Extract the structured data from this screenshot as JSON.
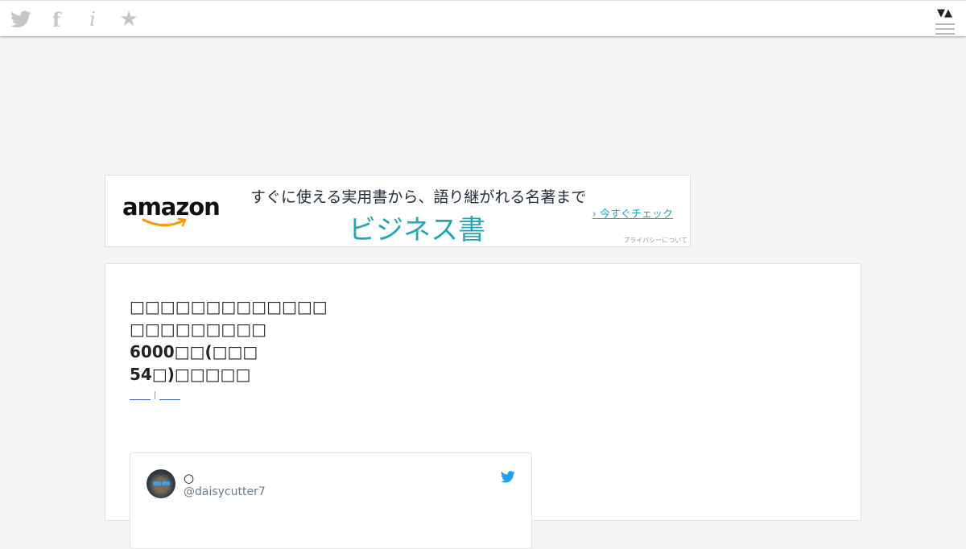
{
  "topbar": {
    "icons": [
      "twitter-icon",
      "facebook-icon",
      "info-icon",
      "star-icon"
    ],
    "facebook_glyph": "f",
    "info_glyph": "i",
    "star_glyph": "★",
    "sort_glyph": "▼▲"
  },
  "ad": {
    "logo": "amazon",
    "tagline": "すぐに使える実用書から、語り継がれる名著まで",
    "headline": "ビジネス書",
    "cta": "› 今すぐチェック",
    "privacy": "プライバシーについて",
    "colors": {
      "accent": "#1fa7ba",
      "smile": "#f90"
    }
  },
  "article": {
    "title_lines": [
      "□□□□□□□□□□□□□",
      "□□□□□□□□□",
      "6000□□(□□□",
      "54□)□□□□□"
    ]
  },
  "tweet": {
    "name": "○",
    "handle": "@daisycutter7",
    "colors": {
      "bird": "#1da1f2"
    }
  }
}
